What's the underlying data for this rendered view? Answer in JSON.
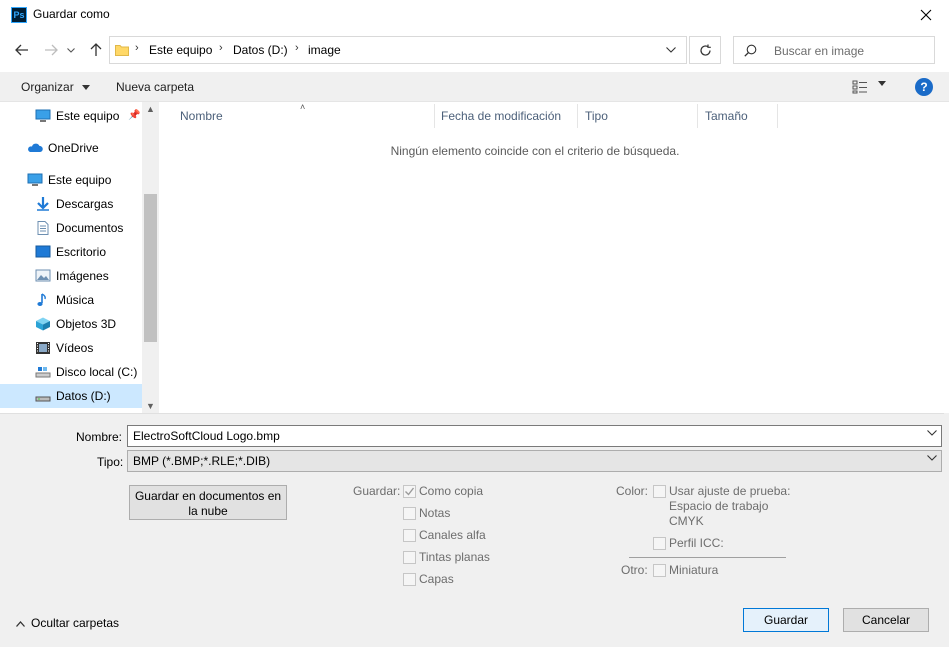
{
  "window": {
    "title": "Guardar como",
    "app_icon_text": "Ps"
  },
  "address": {
    "crumbs": [
      "Este equipo",
      "Datos (D:)",
      "image"
    ],
    "search_placeholder": "Buscar en image"
  },
  "toolbar": {
    "organize_label": "Organizar",
    "new_folder_label": "Nueva carpeta"
  },
  "sidebar": {
    "items": [
      {
        "label": "Este equipo",
        "icon": "computer-icon",
        "pinned": true
      },
      {
        "label": "OneDrive",
        "icon": "cloud-icon"
      },
      {
        "label": "Este equipo",
        "icon": "computer-icon"
      },
      {
        "label": "Descargas",
        "icon": "download-icon"
      },
      {
        "label": "Documentos",
        "icon": "document-icon"
      },
      {
        "label": "Escritorio",
        "icon": "desktop-icon"
      },
      {
        "label": "Imágenes",
        "icon": "image-icon"
      },
      {
        "label": "Música",
        "icon": "music-icon"
      },
      {
        "label": "Objetos 3D",
        "icon": "cube-icon"
      },
      {
        "label": "Vídeos",
        "icon": "video-icon"
      },
      {
        "label": "Disco local (C:)",
        "icon": "drive-icon"
      },
      {
        "label": "Datos (D:)",
        "icon": "drive-icon",
        "selected": true
      }
    ]
  },
  "filelist": {
    "columns": [
      "Nombre",
      "Fecha de modificación",
      "Tipo",
      "Tamaño"
    ],
    "empty_message": "Ningún elemento coincide con el criterio de búsqueda."
  },
  "form": {
    "name_label": "Nombre:",
    "name_value": "ElectroSoftCloud Logo.bmp",
    "type_label": "Tipo:",
    "type_value": "BMP (*.BMP;*.RLE;*.DIB)",
    "cloud_button": "Guardar en documentos en la nube",
    "save_group_label": "Guardar:",
    "save_options": [
      {
        "label": "Como copia",
        "checked": true
      },
      {
        "label": "Notas",
        "checked": false
      },
      {
        "label": "Canales alfa",
        "checked": false
      },
      {
        "label": "Tintas planas",
        "checked": false
      },
      {
        "label": "Capas",
        "checked": false
      }
    ],
    "color_label": "Color:",
    "proof_label_line1": "Usar ajuste de prueba:",
    "proof_label_line2": "Espacio de trabajo",
    "proof_label_line3": "CMYK",
    "icc_label": "Perfil ICC:",
    "other_label": "Otro:",
    "thumbnail_label": "Miniatura"
  },
  "footer": {
    "hide_folders": "Ocultar carpetas",
    "save_button": "Guardar",
    "cancel_button": "Cancelar"
  }
}
